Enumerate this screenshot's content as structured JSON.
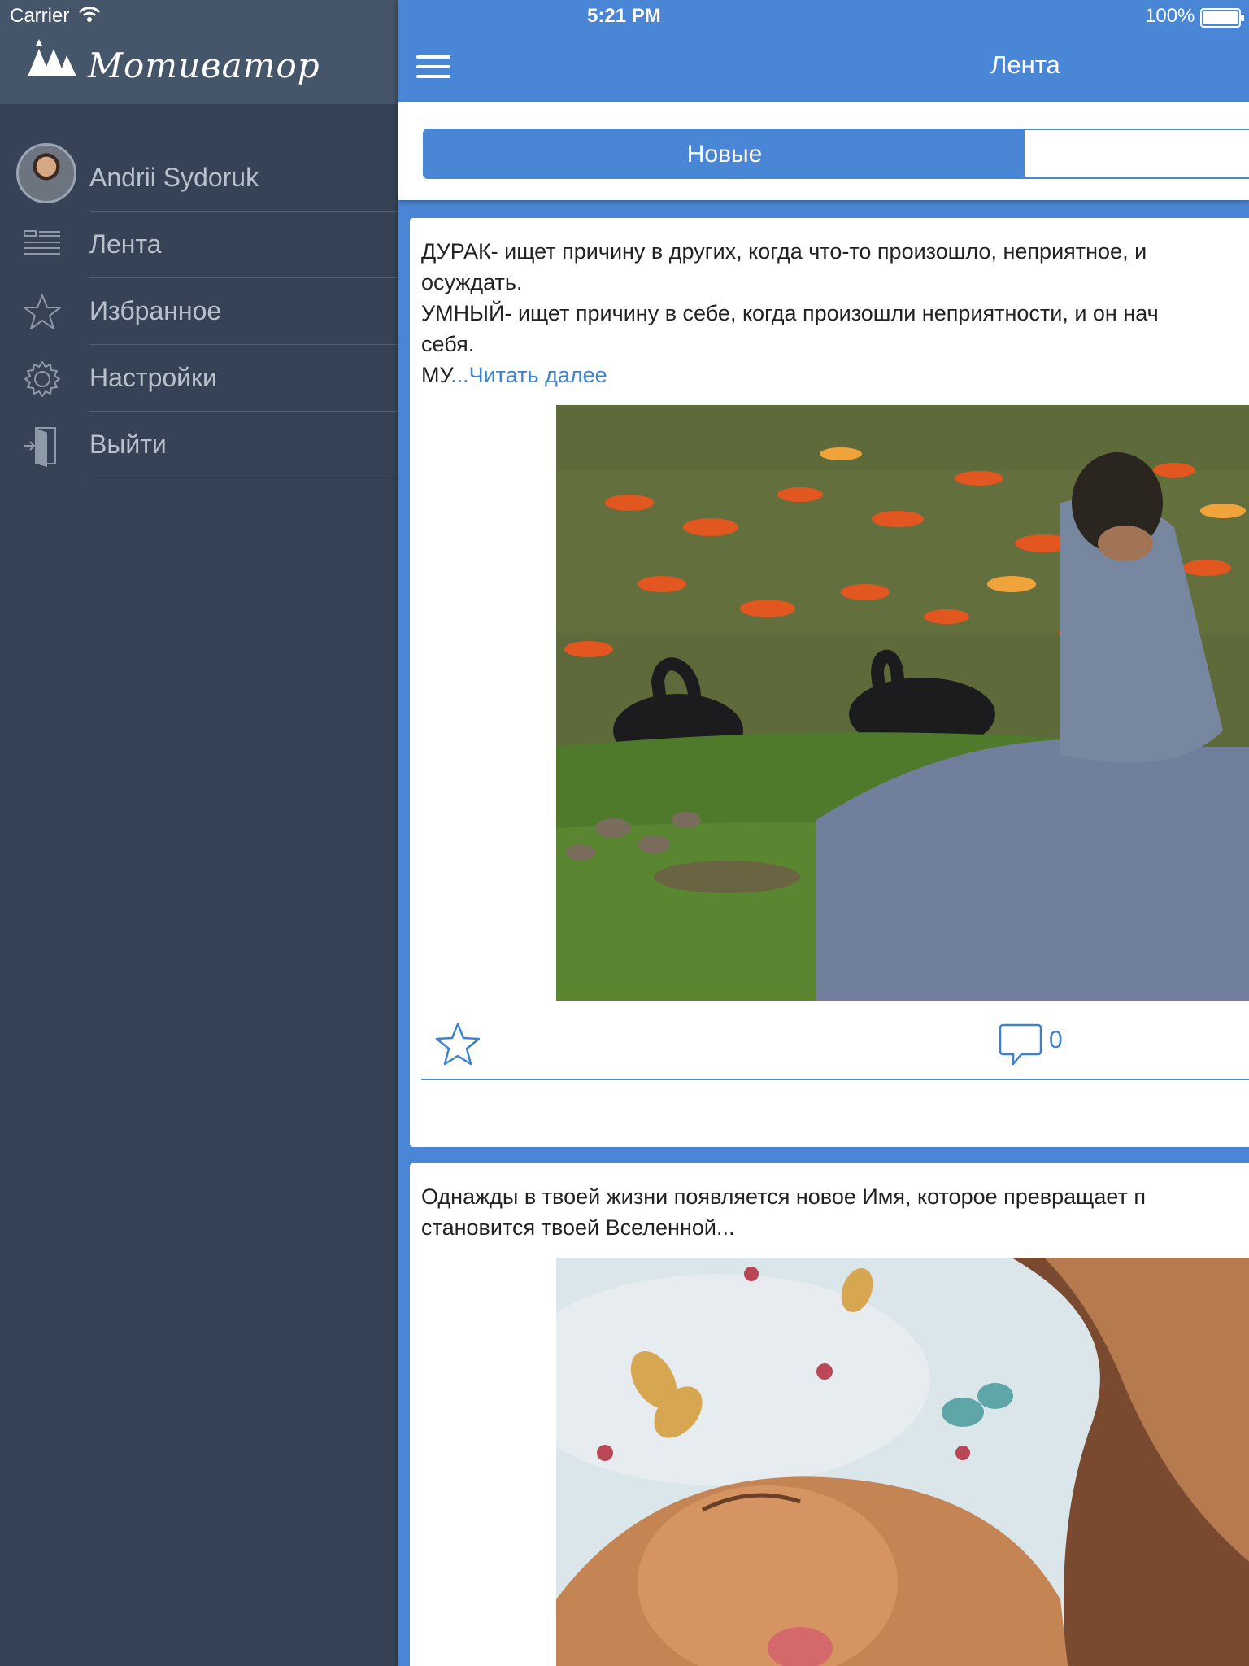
{
  "status_bar": {
    "carrier": "Carrier",
    "time": "5:21 PM",
    "battery": "100%"
  },
  "sidebar": {
    "logo_text": "Мотиватор",
    "profile_name": "Andrii Sydoruk",
    "items": [
      {
        "label": "Лента",
        "icon": "feed-icon"
      },
      {
        "label": "Избранное",
        "icon": "star-icon"
      },
      {
        "label": "Настройки",
        "icon": "gear-icon"
      },
      {
        "label": "Выйти",
        "icon": "logout-icon"
      }
    ]
  },
  "header": {
    "title": "Лента"
  },
  "segments": {
    "active_label": "Новые"
  },
  "posts": [
    {
      "text": "ДУРАК- ищет причину в других, когда что-то произошло, неприятное, и\nосуждать.\nУМНЫЙ- ищет причину в себе, когда произошли неприятности, и он нач\nсебя.\nМУ",
      "read_more": "...Читать далее",
      "comments": "0"
    },
    {
      "text": "Однажды в твоей жизни появляется новое Имя, которое превращает п\nстановится твоей Вселенной..."
    }
  ],
  "colors": {
    "accent": "#4a86d6",
    "sidebar_bg": "#364356",
    "sidebar_header_bg": "#46566a",
    "link": "#3d82d0"
  }
}
